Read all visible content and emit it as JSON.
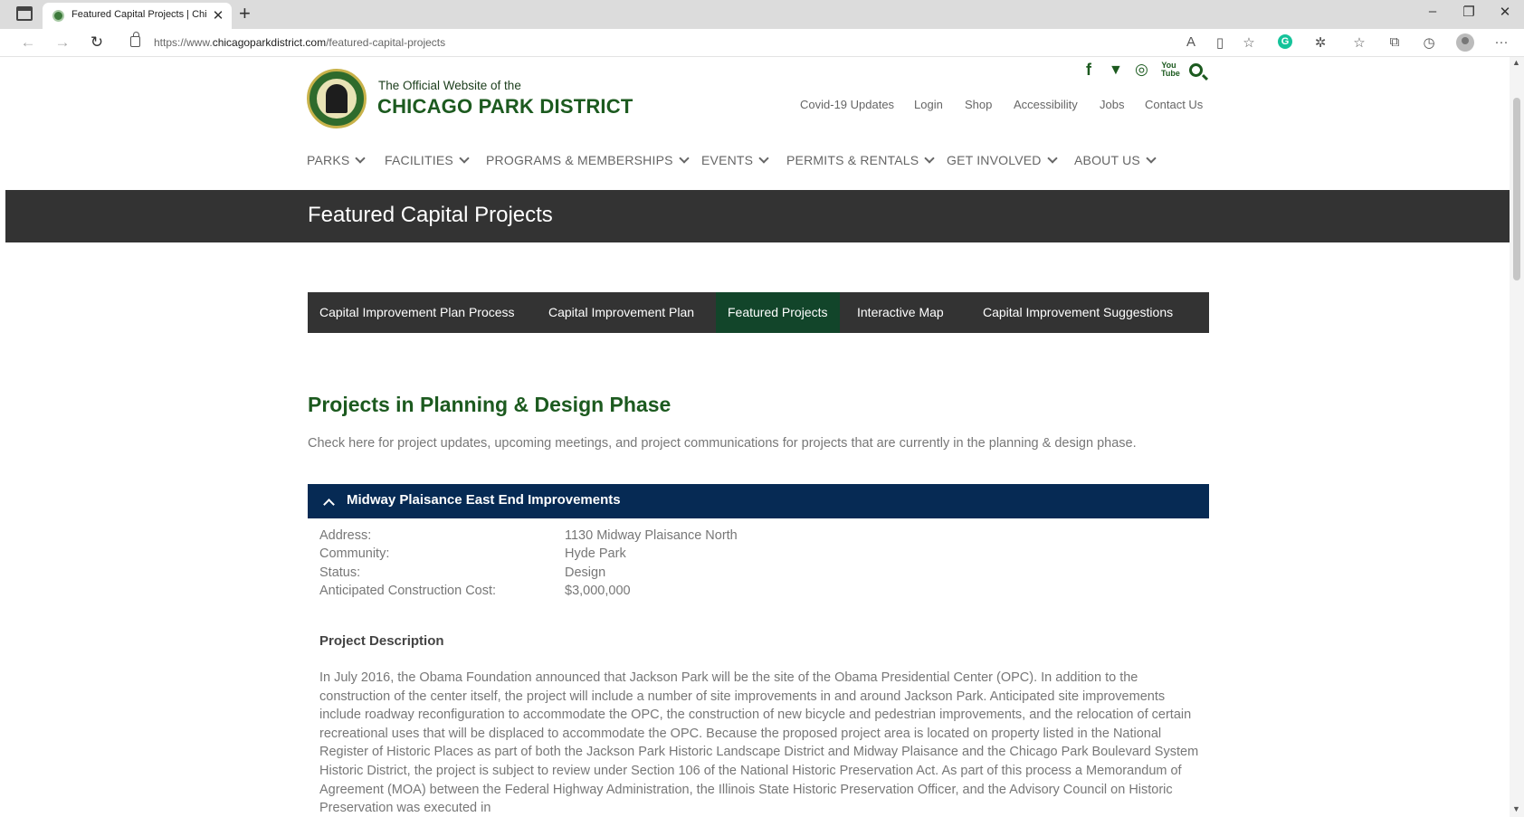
{
  "browser": {
    "tab_title": "Featured Capital Projects | Chicago Park District",
    "tab_close": "✕",
    "new_tab": "+",
    "url_prefix": "https://www.",
    "url_domain": "chicagoparkdistrict.com",
    "url_path": "/featured-capital-projects",
    "window": {
      "minimize": "–",
      "restore": "❐",
      "close": "✕"
    },
    "toolbar_icons": [
      "read-aloud-icon",
      "immersive-reader-icon",
      "favorite-star-icon",
      "grammarly-icon",
      "extensions-icon",
      "favorites-icon",
      "collections-icon",
      "history-icon",
      "profile-icon",
      "more-icon"
    ],
    "grammarly_letter": "G",
    "more": "···"
  },
  "site": {
    "subtitle": "The Official Website of the",
    "name": "CHICAGO PARK DISTRICT",
    "social": {
      "facebook": "f",
      "twitter": "🐦",
      "instagram": "◎",
      "youtube": "You Tube"
    },
    "utility_links": [
      "Covid-19 Updates",
      "Login",
      "Shop",
      "Accessibility",
      "Jobs",
      "Contact Us"
    ],
    "main_nav": [
      "PARKS",
      "FACILITIES",
      "PROGRAMS & MEMBERSHIPS",
      "EVENTS",
      "PERMITS & RENTALS",
      "GET INVOLVED",
      "ABOUT US"
    ]
  },
  "page": {
    "title": "Featured Capital Projects",
    "subnav": [
      "Capital Improvement Plan Process",
      "Capital Improvement Plan",
      "Featured Projects",
      "Interactive Map",
      "Capital Improvement Suggestions"
    ],
    "subnav_active": "Featured Projects",
    "section_title": "Projects in Planning & Design Phase",
    "intro": "Check here for project updates, upcoming meetings, and project communications for projects that are currently in the planning & design phase.",
    "project": {
      "title": "Midway Plaisance East End Improvements",
      "details": [
        {
          "label": "Address:",
          "value": "1130 Midway Plaisance North"
        },
        {
          "label": "Community:",
          "value": "Hyde Park"
        },
        {
          "label": "Status:",
          "value": "Design"
        },
        {
          "label": "Anticipated Construction Cost:",
          "value": "$3,000,000"
        }
      ],
      "description_heading": "Project Description",
      "description": "In July 2016, the Obama Foundation announced that Jackson Park will be the site of the Obama Presidential Center (OPC).  In addition to the construction of the center itself, the project will include a number of site improvements in and around Jackson Park. Anticipated site improvements include roadway reconfiguration to accommodate the OPC, the construction of new bicycle and pedestrian improvements, and the relocation of certain recreational uses that will be displaced to accommodate the OPC. Because the proposed project area is located on property listed in the National Register of Historic Places as part of both the Jackson Park Historic Landscape District and Midway Plaisance and the Chicago Park Boulevard System Historic District, the project is subject to review under Section 106 of the National Historic Preservation Act. As part of this process a Memorandum of Agreement (MOA) between the Federal Highway Administration, the Illinois State Historic Preservation Officer, and the Advisory Council on Historic Preservation was executed in"
    }
  },
  "colors": {
    "brand_green": "#1c5a1f",
    "active_tab_green": "#12452a",
    "banner_dark": "#333333",
    "accordion_navy": "#062a54"
  }
}
